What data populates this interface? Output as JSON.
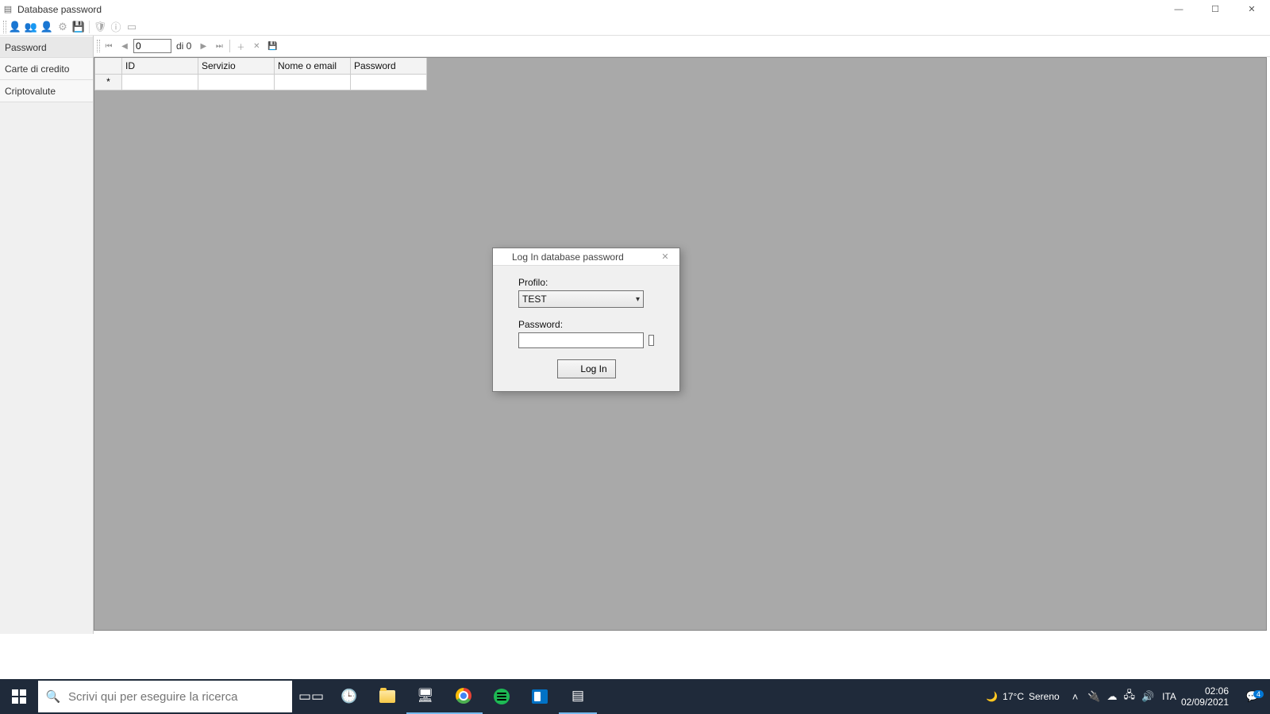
{
  "window": {
    "title": "Database password",
    "controls": {
      "min": "—",
      "max": "☐",
      "close": "✕"
    }
  },
  "sidebar": {
    "items": [
      {
        "label": "Password",
        "active": true
      },
      {
        "label": "Carte di credito",
        "active": false
      },
      {
        "label": "Criptovalute",
        "active": false
      }
    ]
  },
  "navigator": {
    "position": "0",
    "of_text": "di 0"
  },
  "grid": {
    "columns": [
      "ID",
      "Servizio",
      "Nome o email",
      "Password"
    ],
    "new_row_marker": "*"
  },
  "dialog": {
    "title": "Log In database password",
    "profile_label": "Profilo:",
    "profile_value": "TEST",
    "password_label": "Password:",
    "password_value": "",
    "login_button": "Log In"
  },
  "taskbar": {
    "search_placeholder": "Scrivi qui per eseguire la ricerca",
    "weather": {
      "temp": "17°C",
      "cond": "Sereno"
    },
    "lang": "ITA",
    "clock": {
      "time": "02:06",
      "date": "02/09/2021"
    },
    "notif_count": "4"
  }
}
